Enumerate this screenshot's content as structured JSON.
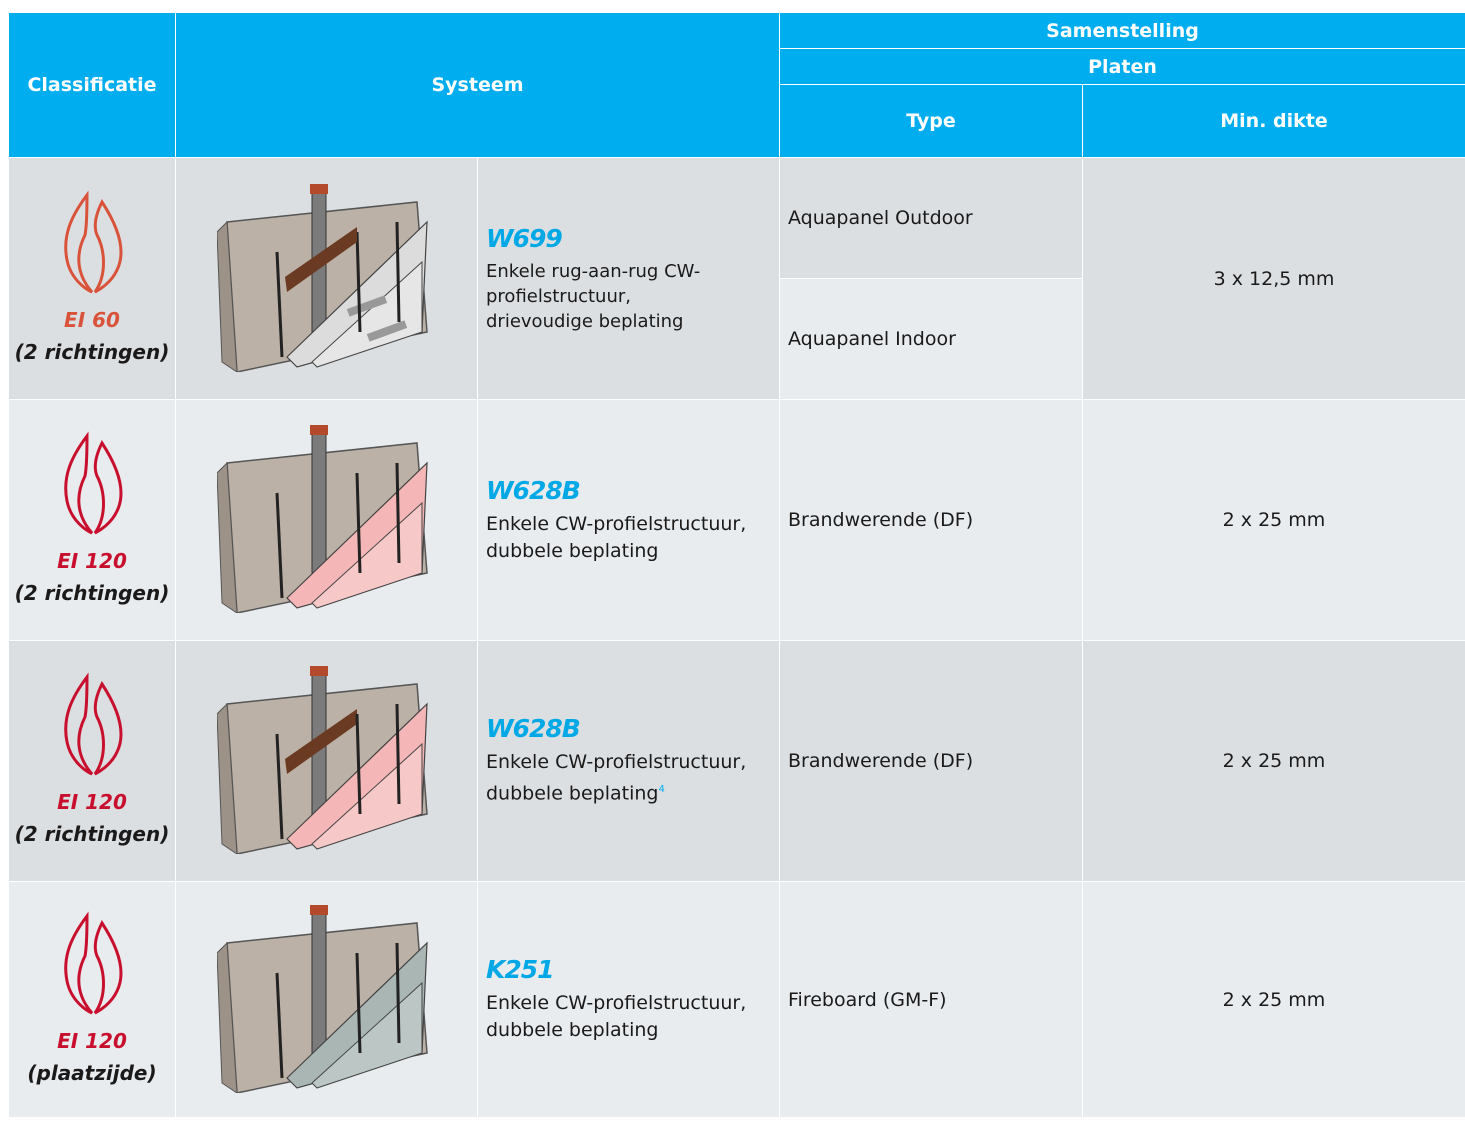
{
  "header": {
    "classificatie": "Classificatie",
    "systeem": "Systeem",
    "samenstelling": "Samenstelling",
    "platen": "Platen",
    "type": "Type",
    "min_dikte": "Min. dikte"
  },
  "rows": [
    {
      "class_code": "EI 60",
      "class_dir": "(2 richtingen)",
      "flame_color": "#d9533b",
      "board_color": "#dcdcdc",
      "system_code": "W699",
      "desc_1": "Enkele rug-aan-rug CW-",
      "desc_2": "profielstructuur,",
      "desc_3": "drievoudige beplating",
      "type_1": "Aquapanel Outdoor",
      "type_2": "Aquapanel Indoor",
      "dikte": "3 x 12,5 mm"
    },
    {
      "class_code": "EI 120",
      "class_dir": "(2 richtingen)",
      "flame_color": "#c8102e",
      "board_color": "#f4b6b6",
      "system_code": "W628B",
      "desc_1": "Enkele CW-profielstructuur,",
      "desc_2": "dubbele beplating",
      "type": "Brandwerende (DF)",
      "dikte": "2 x 25 mm"
    },
    {
      "class_code": "EI 120",
      "class_dir": "(2 richtingen)",
      "flame_color": "#c8102e",
      "board_color": "#f4b6b6",
      "system_code": "W628B",
      "desc_1": "Enkele CW-profielstructuur,",
      "desc_2": "dubbele beplating",
      "footnote": "4",
      "type": "Brandwerende (DF)",
      "dikte": "2 x 25 mm"
    },
    {
      "class_code": "EI 120",
      "class_dir": "(plaatzijde)",
      "flame_color": "#c8102e",
      "board_color": "#a9b6b4",
      "system_code": "K251",
      "desc_1": "Enkele CW-profielstructuur,",
      "desc_2": "dubbele beplating",
      "type": "Fireboard (GM-F)",
      "dikte": "2 x 25 mm"
    }
  ]
}
